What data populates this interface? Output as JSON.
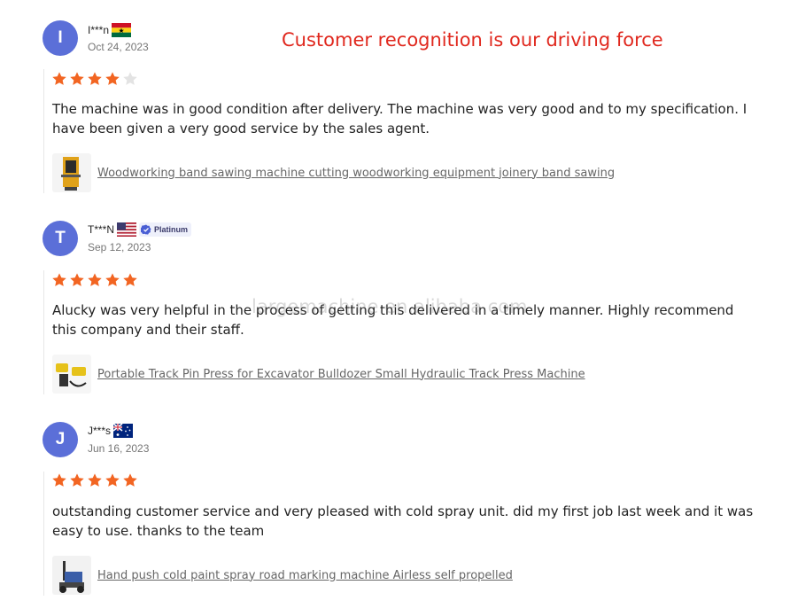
{
  "banner": "Customer recognition is our driving force",
  "watermark": "largemachine.en.alibaba.com",
  "colors": {
    "avatar": "#5b6fd8",
    "star_filled": "#f26522",
    "star_empty": "#e3e3e3",
    "banner": "#e0281e"
  },
  "reviews": [
    {
      "initial": "I",
      "name": "I***n",
      "flag": "ghana-flag",
      "badge": "",
      "date": "Oct 24, 2023",
      "rating": 4,
      "text": "The machine was in good condition after delivery. The machine was very good and to my specification. I have been given a very good service by the sales agent.",
      "product": "Woodworking band sawing machine cutting woodworking equipment joinery band sawing"
    },
    {
      "initial": "T",
      "name": "T***N",
      "flag": "usa-flag",
      "badge": "Platinum",
      "date": "Sep 12, 2023",
      "rating": 5,
      "text": "Alucky was very helpful in the process of getting this delivered in a timely manner. Highly recommend this company and their staff.",
      "product": "Portable Track Pin Press for Excavator Bulldozer Small Hydraulic Track Press Machine"
    },
    {
      "initial": "J",
      "name": "J***s",
      "flag": "australia-flag",
      "badge": "",
      "date": "Jun 16, 2023",
      "rating": 5,
      "text": "outstanding customer service and very pleased with cold spray unit. did my first job last week and it was easy to use. thanks to the team",
      "product": "Hand push cold paint spray road marking machine Airless self propelled"
    }
  ]
}
